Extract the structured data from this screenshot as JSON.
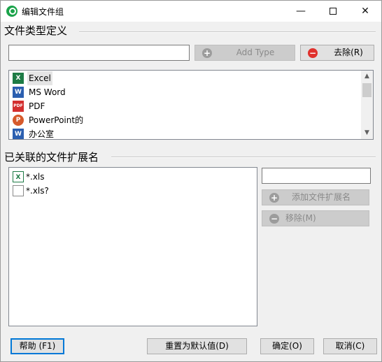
{
  "window": {
    "title": "编辑文件组"
  },
  "controls": {
    "minimize": "—",
    "close": "✕"
  },
  "types_section": {
    "heading": "文件类型定义",
    "name_input_value": "",
    "add_type_label": "Add Type",
    "remove_label": "去除(R)",
    "items": [
      {
        "label": "Excel",
        "icon": "excel-icon",
        "selected": true
      },
      {
        "label": "MS Word",
        "icon": "word-icon",
        "selected": false
      },
      {
        "label": "PDF",
        "icon": "pdf-icon",
        "selected": false
      },
      {
        "label": "PowerPoint的",
        "icon": "powerpoint-icon",
        "selected": false
      },
      {
        "label": "办公室",
        "icon": "office-icon",
        "selected": false
      }
    ]
  },
  "extensions_section": {
    "heading": "已关联的文件扩展名",
    "extension_input_value": "",
    "add_extension_label": "添加文件扩展名",
    "remove_extension_label": "移除(M)",
    "items": [
      {
        "label": "*.xls",
        "icon": "excel-file-icon"
      },
      {
        "label": "*.xls?",
        "icon": "blank-file-icon"
      }
    ]
  },
  "footer": {
    "help_label": "帮助 (F1)",
    "reset_label": "重置为默认值(D)",
    "ok_label": "确定(O)",
    "cancel_label": "取消(C)"
  }
}
